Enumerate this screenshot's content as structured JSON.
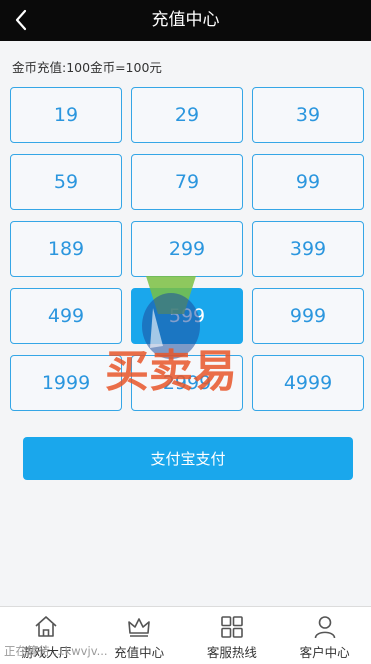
{
  "header": {
    "title": "充值中心",
    "back_icon": "chevron-left-icon"
  },
  "rate_text": "金币充值:100金币=100元",
  "amounts": [
    "19",
    "29",
    "39",
    "59",
    "79",
    "99",
    "189",
    "299",
    "399",
    "499",
    "599",
    "999",
    "1999",
    "2999",
    "4999"
  ],
  "selected_amount": "599",
  "pay_button": "支付宝支付",
  "watermark_text": "买卖易",
  "status_text": "正在等待 ...kwvjv...",
  "tabs": [
    {
      "label": "游戏大厅",
      "icon": "home-icon"
    },
    {
      "label": "充值中心",
      "icon": "crown-icon"
    },
    {
      "label": "客服热线",
      "icon": "grid-icon"
    },
    {
      "label": "客户中心",
      "icon": "user-icon"
    }
  ],
  "colors": {
    "accent": "#1aa7ec",
    "header": "#0a0a0a",
    "watermark": "#e8572a"
  }
}
